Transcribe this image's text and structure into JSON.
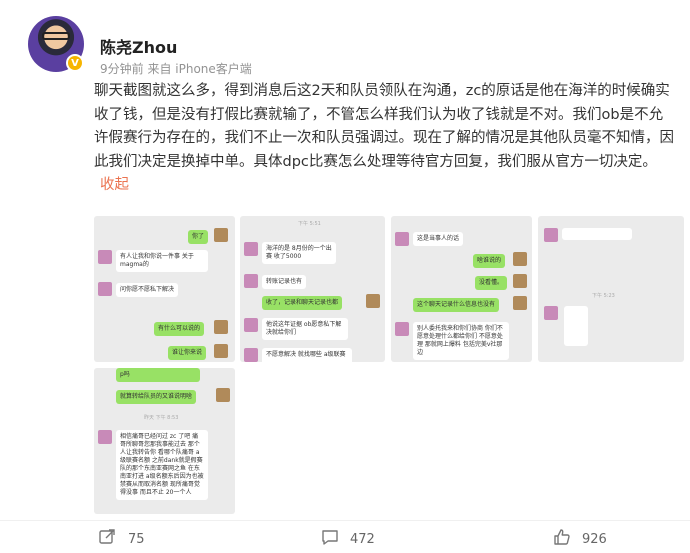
{
  "post": {
    "username": "陈尧Zhou",
    "meta": "9分钟前  来自 iPhone客户端",
    "text": "聊天截图就这么多，得到消息后这2天和队员领队在沟通，zc的原话是他在海洋的时候确实收了钱，但是没有打假比赛就输了，不管怎么样我们认为收了钱就是不对。我们ob是不允许假赛行为存在的，我们不止一次和队员强调过。现在了解的情况是其他队员毫不知情，因此我们决定是换掉中单。具体dpc比赛怎么处理等待官方回复，我们服从官方一切决定。",
    "collapse": "收起"
  },
  "images": {
    "img1": {
      "m1": "你了",
      "m2": "有人让我和你说一件事 关于magma的",
      "m3": "问你愿不愿私下解决",
      "m4": "有什么可以说的",
      "m5": "谁让你来说"
    },
    "img2": {
      "ts": "下午 5:51",
      "m1": "海洋的是 8月份的一个出赛 收了5000",
      "m2": "转账记录也有",
      "m3": "收了，记录和聊天记录也都",
      "m4": "他说这年证据 ob愿意私下解决就给你们",
      "m5": "不愿意解决 就找哪些 a级联赛 ..."
    },
    "img3": {
      "m1": "这是当事人的话",
      "m2": "啥谁说的",
      "m3": "没看懂。",
      "m4": "这个聊天记录什么信息也没有",
      "m5": "别人委托我来和你们协商 你们不愿意处理什么都给你们 不愿意处理 那就网上爆料 包括完美v社那边"
    },
    "img4": {
      "ts": "下午 5:23"
    },
    "img5": {
      "m1": "p吗",
      "m2": "就算转给队员的又谁说明啥",
      "ts": "昨天 下午 8:53",
      "m3": "相信痛哥已经问过 zc 了吧 痛哥所聊哥您那我事能过去 那个人让我转告你 看哪个队痛哥 a级联赛名额 之前dank就是假赛队的那个东南亚赛网之鱼 在东南亚打进 a级名额东后因为也被禁赛从而取消名额 现所痛哥觉得没事 而且不止 20一个人"
    }
  },
  "actions": {
    "repost": "75",
    "comment": "472",
    "like": "926"
  }
}
